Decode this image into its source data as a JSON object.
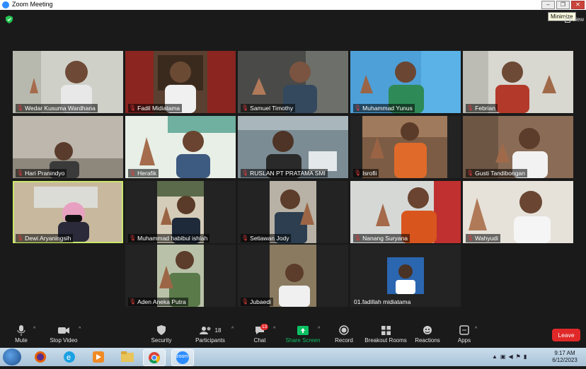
{
  "window": {
    "title": "Zoom Meeting",
    "view_label": "View",
    "tooltip": "Minimize"
  },
  "window_buttons": {
    "minimize": "–",
    "restore": "❐",
    "close": "✕"
  },
  "colors": {
    "accent": "#2d8cff",
    "active_speaker": "#c9e86a",
    "leave": "#e02828",
    "muted": "#e03a3a",
    "share": "#0bc163"
  },
  "participants": [
    {
      "name": "Wedar Kusuma Wardhana",
      "video": true
    },
    {
      "name": "Fadil Midiatama",
      "video": true
    },
    {
      "name": "Samuel Timothy",
      "video": true
    },
    {
      "name": "Muhammad Yunus",
      "video": true
    },
    {
      "name": "Febrian",
      "video": true
    },
    {
      "name": "Hari Pranindyo",
      "video": true
    },
    {
      "name": "Herafik",
      "video": true
    },
    {
      "name": "RUSLAN PT PRATAMA SMI",
      "video": true
    },
    {
      "name": "Isrofii",
      "video": true
    },
    {
      "name": "Gusti Tandibongan",
      "video": true
    },
    {
      "name": "Dewi Aryaningsih",
      "video": true,
      "active": true
    },
    {
      "name": "Muhammad habibul ishlah",
      "video": true
    },
    {
      "name": "Setiawan Jody",
      "video": true
    },
    {
      "name": "Nanang Suryana",
      "video": true
    },
    {
      "name": "Wahyudi",
      "video": true
    },
    {
      "name": "Aden Aneka Putra",
      "video": true
    },
    {
      "name": "Jubaedi",
      "video": true
    },
    {
      "name": "01.fadillah midiatama",
      "video": false,
      "muted": false
    }
  ],
  "toolbar": {
    "mute": "Mute",
    "stop_video": "Stop Video",
    "security": "Security",
    "participants": "Participants",
    "participants_count": "18",
    "chat": "Chat",
    "chat_badge": "13",
    "share_screen": "Share Screen",
    "record": "Record",
    "breakout_rooms": "Breakout Rooms",
    "reactions": "Reactions",
    "apps": "Apps",
    "leave": "Leave"
  },
  "taskbar": {
    "apps": [
      "windows-start",
      "firefox",
      "internet-explorer",
      "media-player",
      "file-explorer",
      "chrome",
      "zoom"
    ],
    "zoom_label": "zoom",
    "time": "9:17 AM",
    "date": "6/12/2023"
  }
}
